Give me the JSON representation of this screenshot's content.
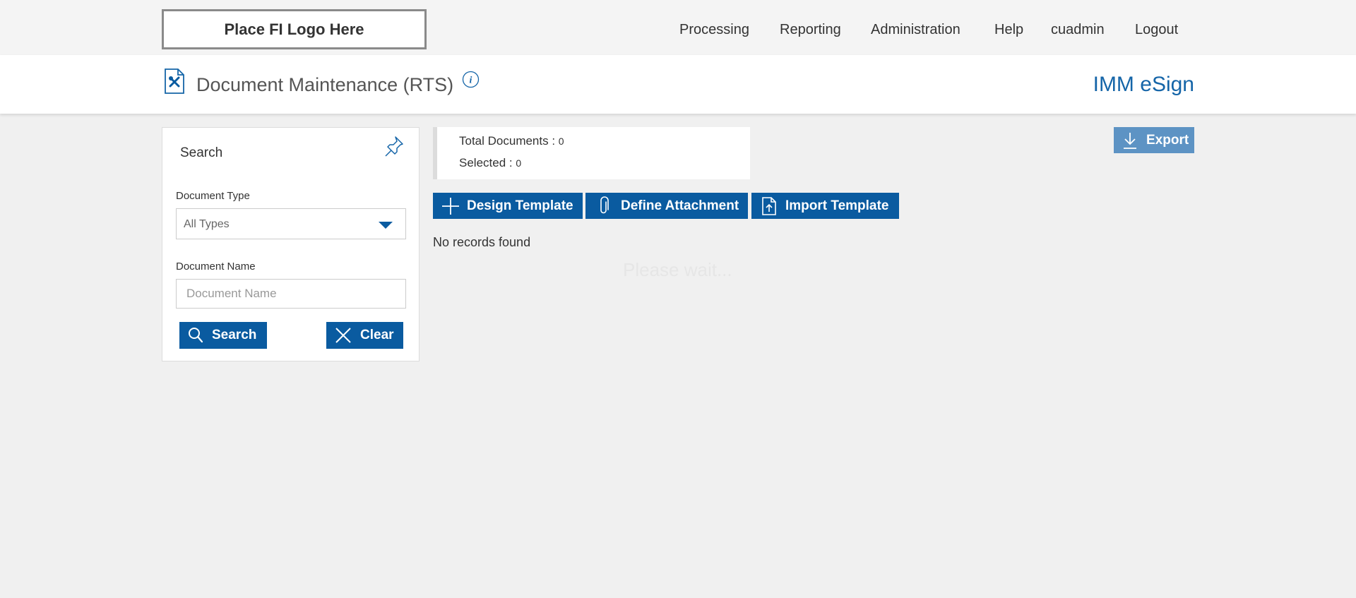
{
  "topbar": {
    "logo_text": "Place FI Logo Here",
    "nav": [
      {
        "label": "Processing"
      },
      {
        "label": "Reporting"
      },
      {
        "label": "Administration"
      },
      {
        "label": "Help"
      },
      {
        "label": "cuadmin"
      },
      {
        "label": "Logout"
      }
    ]
  },
  "header": {
    "page_icon": "document-settings-icon",
    "title": "Document Maintenance (RTS)",
    "info_icon": "info-icon",
    "brand": "IMM eSign"
  },
  "search_panel": {
    "title": "Search",
    "pin_icon": "pin-icon",
    "document_type_label": "Document Type",
    "document_type_value": "All Types",
    "document_name_label": "Document Name",
    "document_name_value": "",
    "document_name_placeholder": "Document Name",
    "search_button": "Search",
    "clear_button": "Clear"
  },
  "summary": {
    "total_label": "Total Documents : ",
    "total_value": "0",
    "selected_label": "Selected : ",
    "selected_value": "0"
  },
  "toolbar": {
    "design_template": "Design Template",
    "define_attachment": "Define Attachment",
    "import_template": "Import Template",
    "export": "Export"
  },
  "results": {
    "empty_message": "No records found",
    "loading_message": "Please wait..."
  },
  "colors": {
    "primary": "#0a5ba0",
    "export_button": "#5d93c4",
    "brand_text": "#1565a8",
    "background": "#f0f0f0"
  }
}
